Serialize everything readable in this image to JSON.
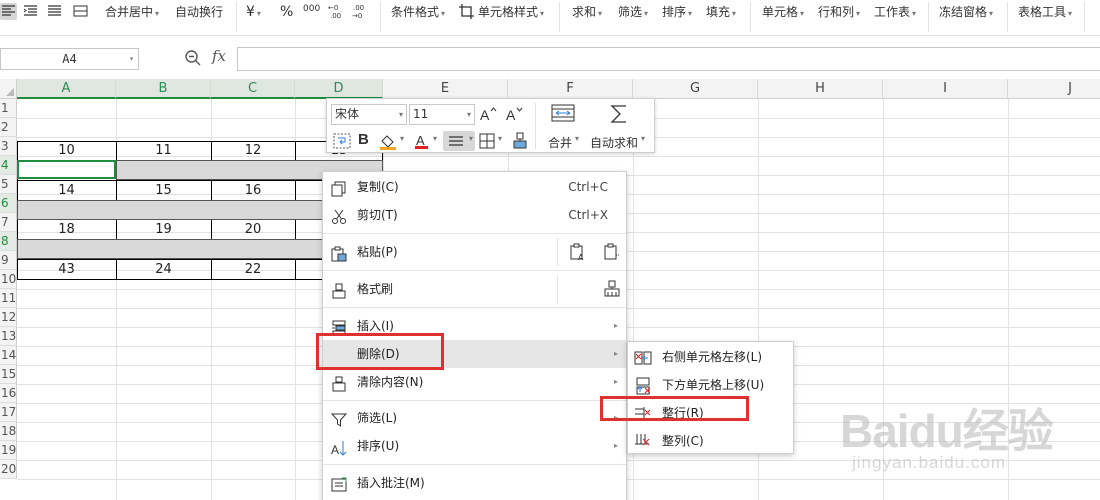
{
  "ribbon": {
    "merge_center": "合并居中",
    "auto_wrap": "自动换行",
    "currency_symbol": "¥",
    "percent_symbol": "%",
    "thousands_symbol": "000",
    "cond_format": "条件格式",
    "cell_style": "单元格样式",
    "sum": "求和",
    "filter": "筛选",
    "sort": "排序",
    "fill": "填充",
    "cell": "单元格",
    "row_col": "行和列",
    "worksheet": "工作表",
    "freeze": "冻结窗格",
    "table_tools": "表格工具"
  },
  "formula_bar": {
    "name_box": "A4",
    "fx": "fx",
    "formula_value": ""
  },
  "columns": [
    "A",
    "B",
    "C",
    "D",
    "E",
    "F",
    "G",
    "H",
    "I",
    "J"
  ],
  "selected_columns": [
    "A",
    "B",
    "C",
    "D"
  ],
  "rows": [
    "1",
    "2",
    "3",
    "4",
    "5",
    "6",
    "7",
    "8",
    "9",
    "10",
    "11",
    "12",
    "13",
    "14",
    "15",
    "16",
    "17",
    "18",
    "19",
    "20"
  ],
  "selected_rows": [
    "4",
    "6",
    "8"
  ],
  "cells": {
    "r3": [
      "10",
      "11",
      "12",
      "13"
    ],
    "r5": [
      "14",
      "15",
      "16"
    ],
    "r7": [
      "18",
      "19",
      "20"
    ],
    "r9": [
      "43",
      "24",
      "22"
    ]
  },
  "mini_toolbar": {
    "font_name": "宋体",
    "font_size": "11",
    "merge": "合并",
    "autosum": "自动求和"
  },
  "context_menu": {
    "copy": "复制(C)",
    "copy_shortcut": "Ctrl+C",
    "cut": "剪切(T)",
    "cut_shortcut": "Ctrl+X",
    "paste": "粘贴(P)",
    "format_painter": "格式刷",
    "insert": "插入(I)",
    "delete": "删除(D)",
    "clear": "清除内容(N)",
    "filter": "筛选(L)",
    "sort": "排序(U)",
    "comment": "插入批注(M)"
  },
  "delete_submenu": {
    "shift_left": "右侧单元格左移(L)",
    "shift_up": "下方单元格上移(U)",
    "entire_row": "整行(R)",
    "entire_col": "整列(C)"
  },
  "watermark": {
    "main": "Baidu经验",
    "sub": "jingyan.baidu.com"
  }
}
